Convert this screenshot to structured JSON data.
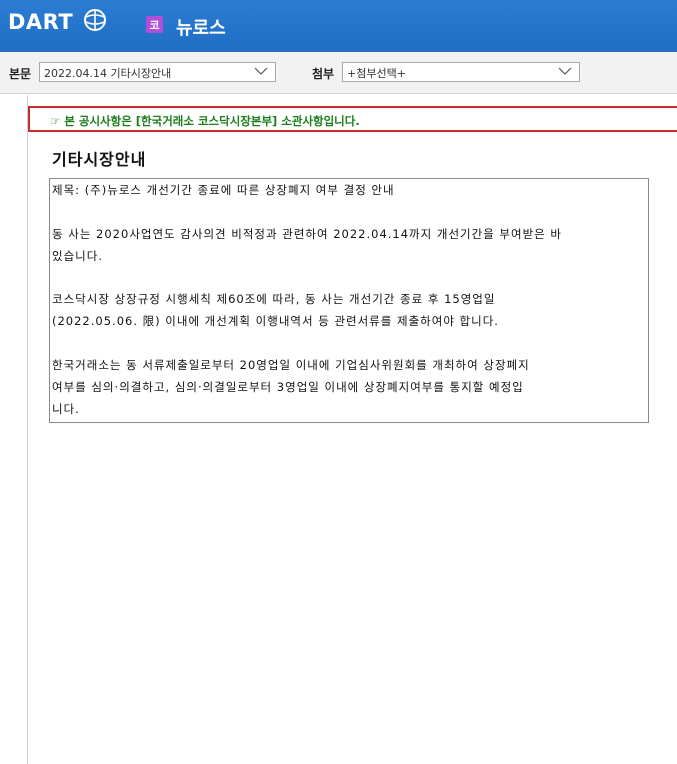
{
  "header": {
    "logo_text": "DART",
    "company_badge": "코",
    "company_name": "뉴로스"
  },
  "toolbar": {
    "main_label": "본문",
    "main_select": "2022.04.14  기타시장안내",
    "attach_label": "첨부",
    "attach_select": "+첨부선택+"
  },
  "notice": {
    "text": "☞ 본 공시사항은 [한국거래소 코스닥시장본부] 소관사항입니다."
  },
  "document": {
    "title": "기타시장안내",
    "subject": "제목: (주)뉴로스 개선기간 종료에 따른 상장폐지 여부 결정 안내",
    "p1_line1": "동 사는 2020사업연도 감사의견 비적정과 관련하여 2022.04.14까지 개선기간을 부여받은 바",
    "p1_line2": "있습니다.",
    "p2_line1": "코스닥시장 상장규정 시행세칙 제60조에 따라, 동 사는 개선기간 종료 후 15영업일",
    "p2_line2": "(2022.05.06. 限) 이내에 개선계획 이행내역서 등 관련서류를 제출하여야 합니다.",
    "p3_line1": "한국거래소는 동 서류제출일로부터 20영업일 이내에 기업심사위원회를 개최하여 상장폐지",
    "p3_line2": "여부를 심의·의결하고, 심의·의결일로부터 3영업일 이내에 상장폐지여부를 통지할 예정입",
    "p3_line3": "니다."
  },
  "colors": {
    "header_blue": "#1f6ec4",
    "notice_border": "#cc2b2b",
    "notice_text": "#1a7f1a",
    "badge_purple": "#b24fd8"
  }
}
